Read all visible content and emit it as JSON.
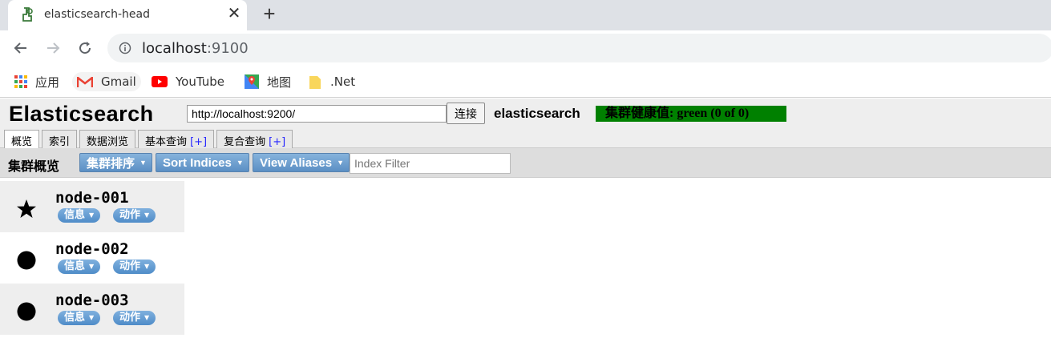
{
  "browser": {
    "tab_title": "elasticsearch-head",
    "url_host": "localhost",
    "url_port": ":9100",
    "bookmarks": [
      "应用",
      "Gmail",
      "YouTube",
      "地图",
      ".Net"
    ]
  },
  "header": {
    "app_title": "Elasticsearch",
    "uri_value": "http://localhost:9200/",
    "connect_label": "连接",
    "cluster_name": "elasticsearch",
    "health_text": "集群健康值: green (0 of 0)",
    "health_color": "#008000"
  },
  "tabs": [
    {
      "label": "概览"
    },
    {
      "label": "索引"
    },
    {
      "label": "数据浏览"
    },
    {
      "label": "基本查询",
      "plus": "[+]"
    },
    {
      "label": "复合查询",
      "plus": "[+]"
    }
  ],
  "overview": {
    "title": "集群概览",
    "sort_cluster": "集群排序",
    "sort_indices": "Sort Indices",
    "view_aliases": "View Aliases",
    "filter_placeholder": "Index Filter"
  },
  "nodes": [
    {
      "name": "node-001",
      "icon": "star-icon",
      "info": "信息",
      "action": "动作"
    },
    {
      "name": "node-002",
      "icon": "circle-icon",
      "info": "信息",
      "action": "动作"
    },
    {
      "name": "node-003",
      "icon": "circle-icon",
      "info": "信息",
      "action": "动作"
    }
  ]
}
